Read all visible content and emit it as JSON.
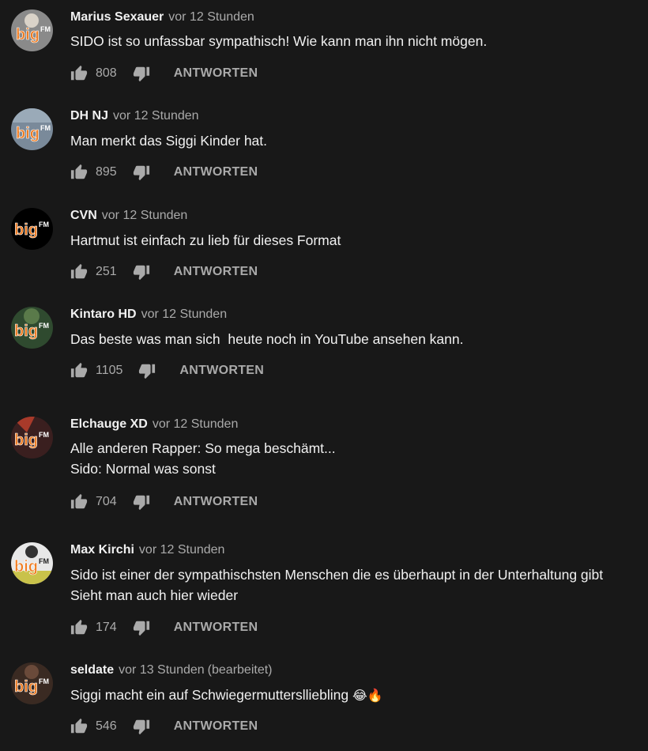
{
  "comments": [
    {
      "author": "Marius Sexauer",
      "time": "vor 12 Stunden",
      "edited": "",
      "lines": [
        "SIDO ist so unfassbar sympathisch! Wie kann man ihn nicht mögen."
      ],
      "likes": "808",
      "reply": "ANTWORTEN",
      "avatar_bg": "#8a8a8a",
      "avatar_logo": "big"
    },
    {
      "author": "DH NJ",
      "time": "vor 12 Stunden",
      "edited": "",
      "lines": [
        "Man merkt das Siggi Kinder hat."
      ],
      "likes": "895",
      "reply": "ANTWORTEN",
      "avatar_bg": "#7a8a9a",
      "avatar_logo": "big"
    },
    {
      "author": "CVN",
      "time": "vor 12 Stunden",
      "edited": "",
      "lines": [
        "Hartmut ist einfach zu lieb für dieses Format"
      ],
      "likes": "251",
      "reply": "ANTWORTEN",
      "avatar_bg": "#000000",
      "avatar_logo": "big"
    },
    {
      "author": "Kintaro HD",
      "time": "vor 12 Stunden",
      "edited": "",
      "lines": [
        "Das beste was man sich  heute noch in YouTube ansehen kann."
      ],
      "likes": "1105",
      "reply": "ANTWORTEN",
      "avatar_bg": "#2f4a2f",
      "avatar_logo": "big"
    },
    {
      "author": "Elchauge XD",
      "time": "vor 12 Stunden",
      "edited": "",
      "lines": [
        "Alle anderen Rapper: So mega beschämt...",
        "Sido: Normal was sonst"
      ],
      "likes": "704",
      "reply": "ANTWORTEN",
      "avatar_bg": "#3a1f1f",
      "avatar_logo": "big"
    },
    {
      "author": "Max Kirchi",
      "time": "vor 12 Stunden",
      "edited": "",
      "lines": [
        "Sido ist einer der sympathischsten Menschen die es überhaupt in der Unterhaltung gibt",
        "Sieht man auch hier wieder"
      ],
      "likes": "174",
      "reply": "ANTWORTEN",
      "avatar_bg": "#c9c24a",
      "avatar_logo": "big"
    },
    {
      "author": "seldate",
      "time": "vor 13 Stunden",
      "edited": "(bearbeitet)",
      "lines": [
        "Siggi macht ein auf Schwiegermutterslliebling"
      ],
      "emoji": "😂🔥",
      "likes": "546",
      "reply": "ANTWORTEN",
      "avatar_bg": "#3a2a22",
      "avatar_logo": "big"
    }
  ],
  "colors": {
    "background": "#181818",
    "text": "#f1f1f1",
    "muted": "#aaaaaa",
    "logo_orange": "#f07b1f"
  },
  "icons": {
    "like": "thumbs-up-icon",
    "dislike": "thumbs-down-icon"
  }
}
